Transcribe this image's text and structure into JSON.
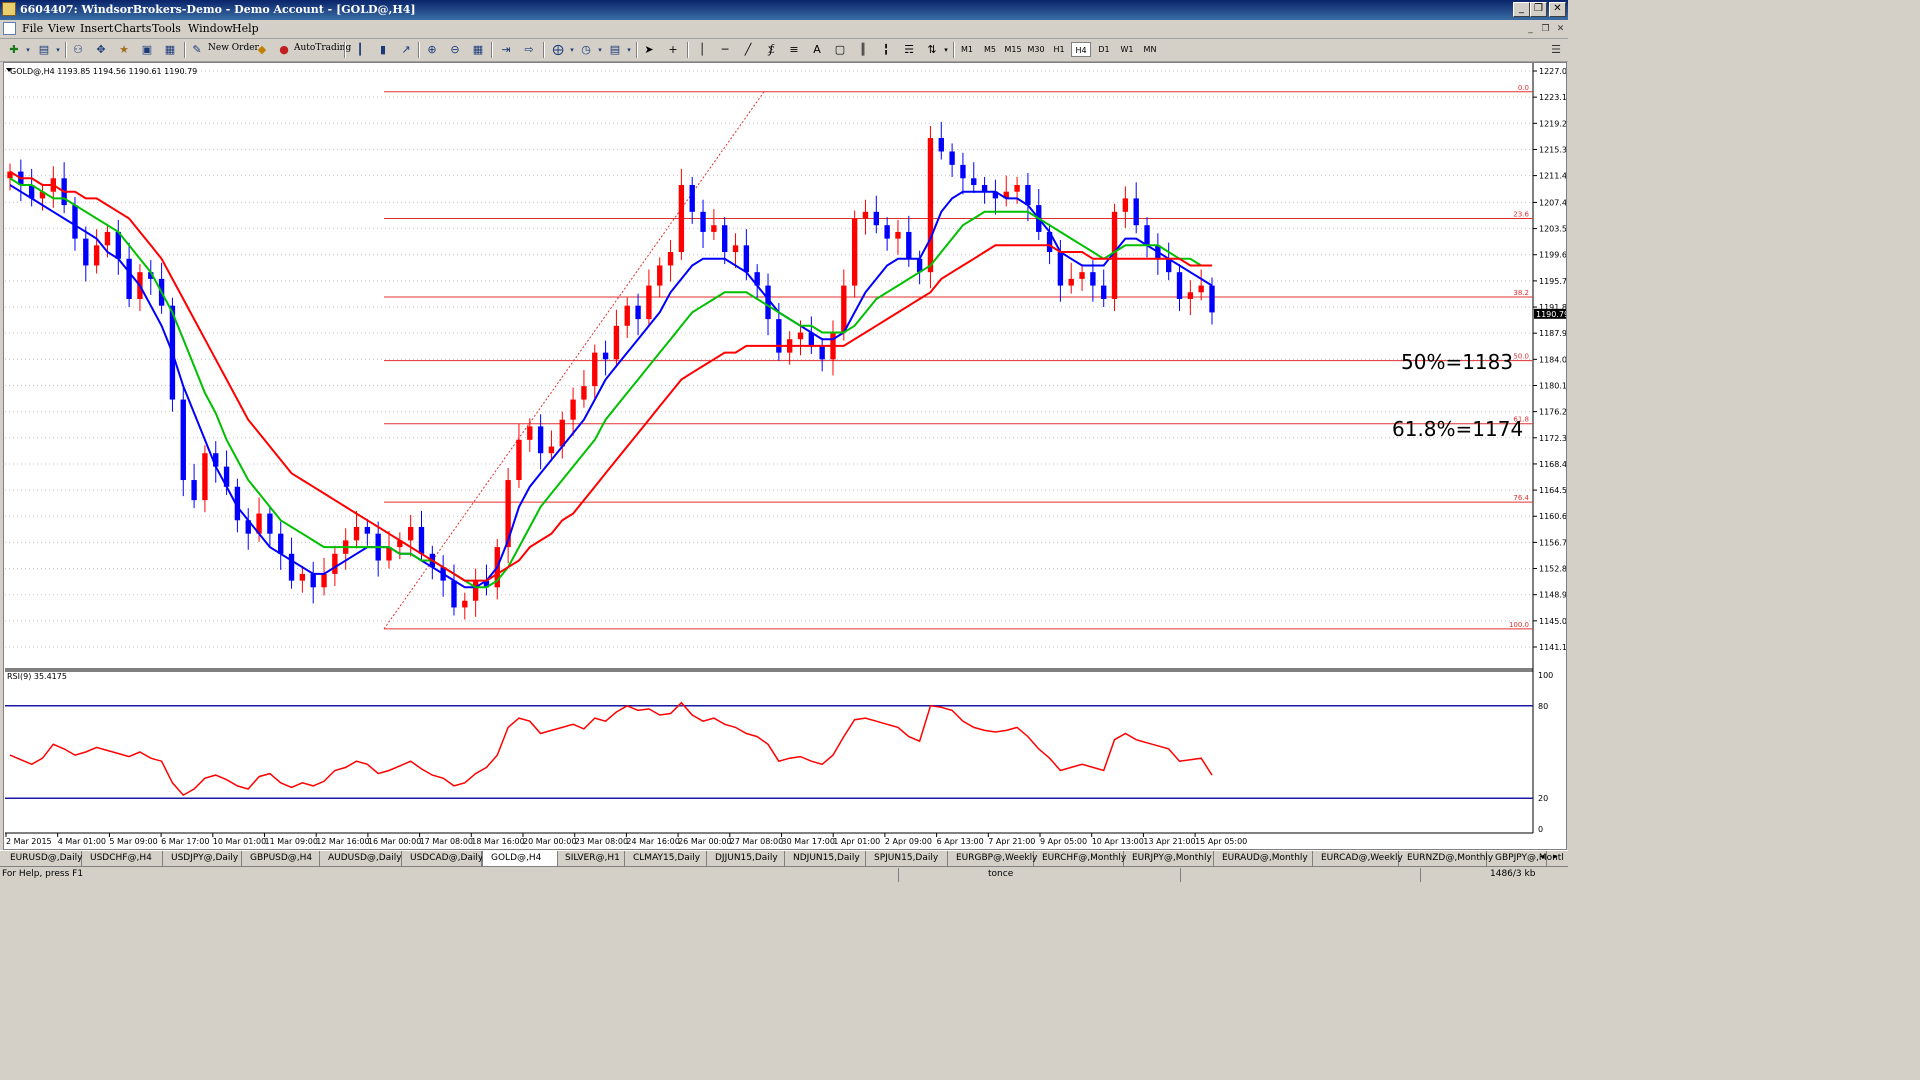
{
  "window": {
    "title": "6604407: WindsorBrokers-Demo - Demo Account - [GOLD@,H4]",
    "controls": [
      "minimize",
      "restore",
      "close"
    ]
  },
  "menu": {
    "items": [
      "File",
      "View",
      "Insert",
      "Charts",
      "Tools",
      "Window",
      "Help"
    ]
  },
  "toolbar": {
    "new_order": "New Order",
    "autotrading": "AutoTrading",
    "timeframes": [
      "M1",
      "M5",
      "M15",
      "M30",
      "H1",
      "H4",
      "D1",
      "W1",
      "MN"
    ],
    "active_timeframe": "H4"
  },
  "chart": {
    "header": "GOLD@,H4  1193.85 1194.56 1190.61 1190.79",
    "current_price": "1190.79",
    "price_ticks": [
      "1227.00",
      "1223.10",
      "1219.20",
      "1215.30",
      "1211.40",
      "1207.40",
      "1203.50",
      "1199.60",
      "1195.70",
      "1191.80",
      "1187.90",
      "1184.00",
      "1180.10",
      "1176.20",
      "1172.30",
      "1168.40",
      "1164.50",
      "1160.60",
      "1156.70",
      "1152.80",
      "1148.90",
      "1145.00",
      "1141.10"
    ],
    "fib_level_labels": [
      "0.0",
      "23.6",
      "38.2",
      "50.0",
      "61.8",
      "76.4",
      "100.0"
    ],
    "annotation_50": "50%=1183",
    "annotation_618": "61.8%=1174",
    "time_ticks": [
      "2 Mar 2015",
      "4 Mar 01:00",
      "5 Mar 09:00",
      "6 Mar 17:00",
      "10 Mar 01:00",
      "11 Mar 09:00",
      "12 Mar 16:00",
      "16 Mar 00:00",
      "17 Mar 08:00",
      "18 Mar 16:00",
      "20 Mar 00:00",
      "23 Mar 08:00",
      "24 Mar 16:00",
      "26 Mar 00:00",
      "27 Mar 08:00",
      "30 Mar 17:00",
      "1 Apr 01:00",
      "2 Apr 09:00",
      "6 Apr 13:00",
      "7 Apr 21:00",
      "9 Apr 05:00",
      "10 Apr 13:00",
      "13 Apr 21:00",
      "15 Apr 05:00"
    ]
  },
  "rsi": {
    "label": "RSI(9) 35.4175",
    "ticks": [
      "100",
      "80",
      "20",
      "0"
    ]
  },
  "chart_data": {
    "type": "line",
    "title": "GOLD@,H4",
    "ohlc_last": {
      "open": 1193.85,
      "high": 1194.56,
      "low": 1190.61,
      "close": 1190.79
    },
    "ylim": [
      1141.1,
      1227.0
    ],
    "fibonacci": [
      {
        "level": "0.0",
        "price": 1223.9
      },
      {
        "level": "23.6",
        "price": 1205.0
      },
      {
        "level": "38.2",
        "price": 1193.3
      },
      {
        "level": "50.0",
        "price": 1183.8
      },
      {
        "level": "61.8",
        "price": 1174.4
      },
      {
        "level": "76.4",
        "price": 1162.7
      },
      {
        "level": "100.0",
        "price": 1143.8
      }
    ],
    "series": [
      {
        "name": "price",
        "color": "#0000ff",
        "values": [
          1212,
          1210,
          1208,
          1209,
          1211,
          1207,
          1202,
          1198,
          1201,
          1203,
          1199,
          1193,
          1197,
          1196,
          1192,
          1178,
          1166,
          1163,
          1170,
          1168,
          1165,
          1160,
          1158,
          1161,
          1158,
          1155,
          1151,
          1152,
          1150,
          1152,
          1155,
          1157,
          1159,
          1158,
          1154,
          1156,
          1157,
          1159,
          1155,
          1153,
          1151,
          1147,
          1148,
          1151,
          1150,
          1156,
          1166,
          1172,
          1174,
          1170,
          1171,
          1175,
          1178,
          1180,
          1185,
          1184,
          1189,
          1192,
          1190,
          1195,
          1198,
          1200,
          1210,
          1206,
          1203,
          1204,
          1200,
          1201,
          1197,
          1195,
          1190,
          1185,
          1187,
          1188,
          1186,
          1184,
          1188,
          1195,
          1205,
          1206,
          1204,
          1202,
          1203,
          1199,
          1197,
          1217,
          1215,
          1213,
          1211,
          1210,
          1209,
          1208,
          1209,
          1210,
          1207,
          1203,
          1200,
          1195,
          1196,
          1197,
          1195,
          1193,
          1206,
          1208,
          1204,
          1201,
          1199,
          1197,
          1193,
          1194,
          1195,
          1191
        ]
      },
      {
        "name": "ma_fast",
        "color": "#0000ff",
        "values": [
          1210,
          1209,
          1208,
          1207,
          1206,
          1205,
          1204,
          1203,
          1202,
          1200,
          1199,
          1197,
          1195,
          1192,
          1189,
          1185,
          1180,
          1176,
          1172,
          1168,
          1165,
          1162,
          1160,
          1158,
          1156,
          1155,
          1154,
          1153,
          1152,
          1152,
          1153,
          1154,
          1155,
          1156,
          1156,
          1156,
          1155,
          1155,
          1154,
          1153,
          1152,
          1151,
          1150,
          1150,
          1151,
          1153,
          1157,
          1162,
          1165,
          1167,
          1169,
          1171,
          1173,
          1175,
          1178,
          1181,
          1183,
          1185,
          1187,
          1189,
          1191,
          1194,
          1196,
          1198,
          1199,
          1199,
          1199,
          1198,
          1197,
          1195,
          1193,
          1191,
          1190,
          1189,
          1188,
          1187,
          1187,
          1188,
          1191,
          1194,
          1196,
          1198,
          1199,
          1199,
          1199,
          1202,
          1206,
          1208,
          1209,
          1209,
          1209,
          1209,
          1208,
          1208,
          1207,
          1205,
          1203,
          1200,
          1199,
          1198,
          1198,
          1198,
          1200,
          1202,
          1202,
          1201,
          1200,
          1199,
          1198,
          1197,
          1196,
          1195
        ]
      },
      {
        "name": "ma_mid",
        "color": "#00c000",
        "values": [
          1211,
          1210,
          1210,
          1209,
          1208,
          1208,
          1207,
          1206,
          1205,
          1204,
          1203,
          1201,
          1199,
          1197,
          1194,
          1191,
          1187,
          1183,
          1179,
          1176,
          1172,
          1169,
          1166,
          1164,
          1162,
          1160,
          1159,
          1158,
          1157,
          1156,
          1156,
          1156,
          1156,
          1156,
          1156,
          1156,
          1155,
          1155,
          1154,
          1154,
          1153,
          1152,
          1151,
          1150,
          1150,
          1151,
          1153,
          1156,
          1159,
          1162,
          1164,
          1166,
          1168,
          1170,
          1172,
          1175,
          1177,
          1179,
          1181,
          1183,
          1185,
          1187,
          1189,
          1191,
          1192,
          1193,
          1194,
          1194,
          1194,
          1193,
          1192,
          1191,
          1190,
          1189,
          1189,
          1188,
          1188,
          1188,
          1189,
          1191,
          1193,
          1194,
          1195,
          1196,
          1197,
          1198,
          1200,
          1202,
          1204,
          1205,
          1206,
          1206,
          1206,
          1206,
          1206,
          1205,
          1204,
          1203,
          1202,
          1201,
          1200,
          1199,
          1200,
          1201,
          1201,
          1201,
          1201,
          1200,
          1199,
          1199,
          1198,
          1198
        ]
      },
      {
        "name": "ma_slow",
        "color": "#ff0000",
        "values": [
          1212,
          1211,
          1211,
          1210,
          1210,
          1209,
          1209,
          1208,
          1208,
          1207,
          1206,
          1205,
          1203,
          1201,
          1199,
          1196,
          1193,
          1190,
          1187,
          1184,
          1181,
          1178,
          1175,
          1173,
          1171,
          1169,
          1167,
          1166,
          1165,
          1164,
          1163,
          1162,
          1161,
          1160,
          1159,
          1158,
          1157,
          1156,
          1155,
          1154,
          1153,
          1152,
          1151,
          1151,
          1151,
          1152,
          1153,
          1154,
          1156,
          1157,
          1158,
          1160,
          1161,
          1163,
          1165,
          1167,
          1169,
          1171,
          1173,
          1175,
          1177,
          1179,
          1181,
          1182,
          1183,
          1184,
          1185,
          1185,
          1186,
          1186,
          1186,
          1186,
          1186,
          1186,
          1186,
          1186,
          1186,
          1186,
          1187,
          1188,
          1189,
          1190,
          1191,
          1192,
          1193,
          1194,
          1196,
          1197,
          1198,
          1199,
          1200,
          1201,
          1201,
          1201,
          1201,
          1201,
          1201,
          1200,
          1200,
          1200,
          1199,
          1199,
          1199,
          1199,
          1199,
          1199,
          1199,
          1199,
          1199,
          1198,
          1198,
          1198
        ]
      }
    ],
    "rsi": {
      "name": "RSI(9)",
      "last": 35.4175,
      "ylim": [
        0,
        100
      ],
      "levels": [
        80,
        20
      ],
      "values": [
        48,
        45,
        42,
        46,
        55,
        52,
        48,
        50,
        53,
        51,
        49,
        47,
        50,
        46,
        44,
        30,
        22,
        26,
        33,
        35,
        32,
        28,
        26,
        34,
        36,
        30,
        27,
        30,
        28,
        31,
        38,
        40,
        44,
        42,
        36,
        38,
        41,
        44,
        39,
        35,
        33,
        28,
        30,
        36,
        40,
        48,
        66,
        72,
        70,
        62,
        64,
        66,
        68,
        65,
        72,
        70,
        76,
        80,
        77,
        78,
        74,
        75,
        82,
        74,
        70,
        72,
        68,
        66,
        62,
        60,
        55,
        44,
        46,
        47,
        44,
        42,
        48,
        60,
        71,
        72,
        70,
        68,
        66,
        60,
        57,
        80,
        79,
        77,
        70,
        66,
        64,
        63,
        64,
        66,
        60,
        52,
        46,
        38,
        40,
        42,
        40,
        38,
        58,
        62,
        58,
        56,
        54,
        52,
        44,
        45,
        46,
        35
      ]
    }
  },
  "tabs": [
    "EURUSD@,Daily",
    "USDCHF@,H4",
    "USDJPY@,Daily",
    "GBPUSD@,H4",
    "AUDUSD@,Daily",
    "USDCAD@,Daily",
    "GOLD@,H4",
    "SILVER@,H1",
    "CLMAY15,Daily",
    "DJJUN15,Daily",
    "NDJUN15,Daily",
    "SPJUN15,Daily",
    "EURGBP@,Weekly",
    "EURCHF@,Monthly",
    "EURJPY@,Monthly",
    "EURAUD@,Monthly",
    "EURCAD@,Weekly",
    "EURNZD@,Monthly",
    "GBPJPY@,Montl"
  ],
  "active_tab": "GOLD@,H4",
  "status": {
    "help": "For Help, press F1",
    "profile": "tonce",
    "traffic": "1486/3 kb"
  }
}
